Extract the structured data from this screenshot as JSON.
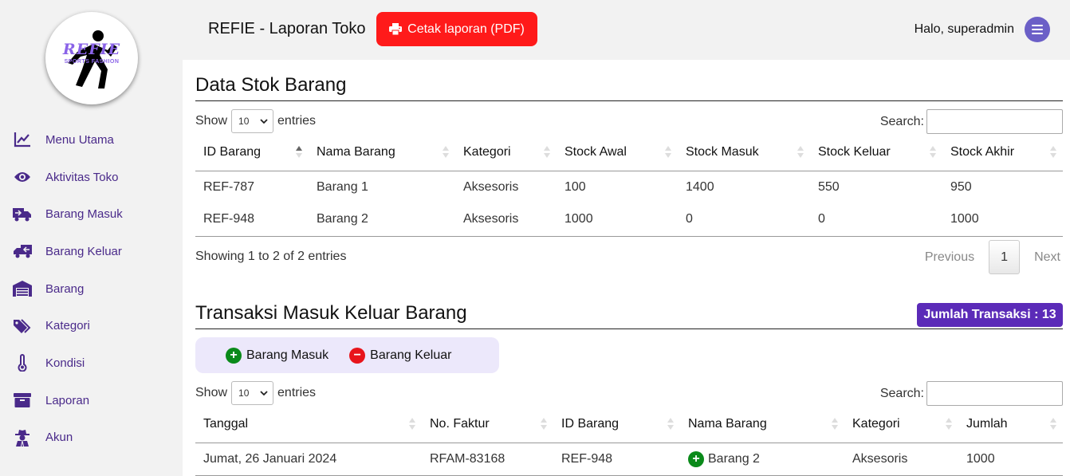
{
  "logo": {
    "title": "REFIE",
    "subtitle": "SPORTS FASHION"
  },
  "nav": [
    {
      "label": "Menu Utama",
      "icon": "chart-line-icon"
    },
    {
      "label": "Aktivitas Toko",
      "icon": "eye-icon"
    },
    {
      "label": "Barang Masuk",
      "icon": "truck-incoming-icon"
    },
    {
      "label": "Barang Keluar",
      "icon": "truck-outgoing-icon"
    },
    {
      "label": "Barang",
      "icon": "warehouse-icon"
    },
    {
      "label": "Kategori",
      "icon": "tags-icon"
    },
    {
      "label": "Kondisi",
      "icon": "thermometer-icon"
    },
    {
      "label": "Laporan",
      "icon": "archive-box-icon"
    },
    {
      "label": "Akun",
      "icon": "user-secret-icon"
    }
  ],
  "header": {
    "title": "REFIE - Laporan Toko",
    "print_button": "Cetak laporan (PDF)",
    "greeting": "Halo, superadmin"
  },
  "stock": {
    "title": "Data Stok Barang",
    "show_label": "Show",
    "entries_value": "10",
    "entries_label": "entries",
    "search_label": "Search:",
    "columns": [
      "ID Barang",
      "Nama Barang",
      "Kategori",
      "Stock Awal",
      "Stock Masuk",
      "Stock Keluar",
      "Stock Akhir"
    ],
    "rows": [
      [
        "REF-787",
        "Barang 1",
        "Aksesoris",
        "100",
        "1400",
        "550",
        "950"
      ],
      [
        "REF-948",
        "Barang 2",
        "Aksesoris",
        "1000",
        "0",
        "0",
        "1000"
      ]
    ],
    "info": "Showing 1 to 2 of 2 entries",
    "previous": "Previous",
    "page": "1",
    "next": "Next"
  },
  "transactions": {
    "title": "Transaksi Masuk Keluar Barang",
    "count_badge": "Jumlah Transaksi : 13",
    "legend_in": "Barang Masuk",
    "legend_out": "Barang Keluar",
    "show_label": "Show",
    "entries_value": "10",
    "entries_label": "entries",
    "search_label": "Search:",
    "columns": [
      "Tanggal",
      "No. Faktur",
      "ID Barang",
      "Nama Barang",
      "Kategori",
      "Jumlah"
    ],
    "rows": [
      [
        "Jumat, 26 Januari 2024",
        "RFAM-83168",
        "REF-948",
        "Barang 2",
        "Aksesoris",
        "1000"
      ]
    ]
  },
  "colors": {
    "accent": "#5b2bb8",
    "print_button": "#ff1a1a",
    "incoming": "#0a8a1a",
    "outgoing": "#e8141b",
    "nav_text": "#4a2a8a"
  }
}
